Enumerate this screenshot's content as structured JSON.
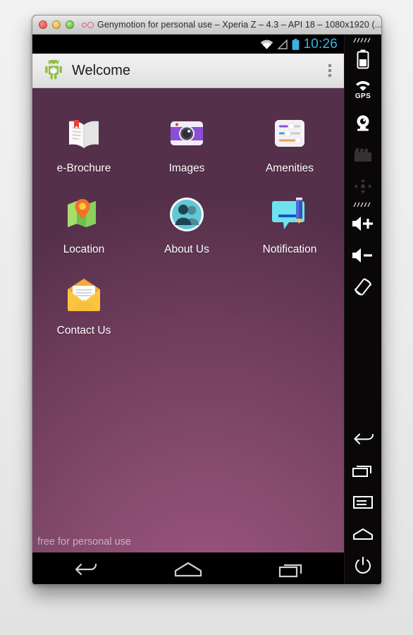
{
  "window": {
    "title": "Genymotion for personal use – Xperia Z – 4.3 – API 18 – 1080x1920 (...",
    "logo_name": "genymotion-logo",
    "controls": {
      "close": "close",
      "minimize": "minimize",
      "zoom": "zoom"
    }
  },
  "statusbar": {
    "time": "10:26",
    "icons": [
      "wifi-icon",
      "signal-icon",
      "battery-icon"
    ],
    "accent_color": "#3bb3e0"
  },
  "actionbar": {
    "app_icon": "android-robot-icon",
    "title": "Welcome",
    "overflow_label": "overflow-menu"
  },
  "home": {
    "background_colors": {
      "light": "#a45b84",
      "dark": "#55304a"
    },
    "watermark": "free for personal use",
    "rows": [
      [
        {
          "label": "e-Brochure",
          "icon": "book-icon"
        },
        {
          "label": "Images",
          "icon": "camera-icon"
        },
        {
          "label": "Amenities",
          "icon": "sliders-icon"
        }
      ],
      [
        {
          "label": "Location",
          "icon": "map-pin-icon"
        },
        {
          "label": "About Us",
          "icon": "people-icon"
        },
        {
          "label": "Notification",
          "icon": "speech-bubble-pencil-icon"
        }
      ],
      [
        {
          "label": "Contact Us",
          "icon": "envelope-icon"
        }
      ]
    ]
  },
  "navbar": {
    "buttons": [
      {
        "name": "back-button",
        "icon": "back-arrow-icon"
      },
      {
        "name": "home-button",
        "icon": "home-icon"
      },
      {
        "name": "recents-button",
        "icon": "recents-icon"
      }
    ]
  },
  "sidebar": {
    "top_items": [
      {
        "name": "battery-control",
        "icon": "battery-icon",
        "label": "",
        "enabled": true
      },
      {
        "name": "gps-control",
        "icon": "gps-icon",
        "label": "GPS",
        "enabled": true
      },
      {
        "name": "camera-control",
        "icon": "webcam-icon",
        "label": "",
        "enabled": true
      },
      {
        "name": "video-control",
        "icon": "clapperboard-icon",
        "label": "",
        "enabled": false
      },
      {
        "name": "dpad-control",
        "icon": "dpad-icon",
        "label": "",
        "enabled": false
      },
      {
        "name": "volume-up",
        "icon": "volume-up-icon",
        "label": "",
        "enabled": true
      },
      {
        "name": "volume-down",
        "icon": "volume-down-icon",
        "label": "",
        "enabled": true
      },
      {
        "name": "rotate-control",
        "icon": "rotate-icon",
        "label": "",
        "enabled": true
      }
    ],
    "bottom_items": [
      {
        "name": "back-control",
        "icon": "back-arrow-icon",
        "enabled": true
      },
      {
        "name": "recents-control",
        "icon": "recents-icon",
        "enabled": true
      },
      {
        "name": "menu-control",
        "icon": "menu-icon",
        "enabled": true
      },
      {
        "name": "home-control",
        "icon": "home-icon",
        "enabled": true
      },
      {
        "name": "power-control",
        "icon": "power-icon",
        "enabled": true
      }
    ]
  }
}
